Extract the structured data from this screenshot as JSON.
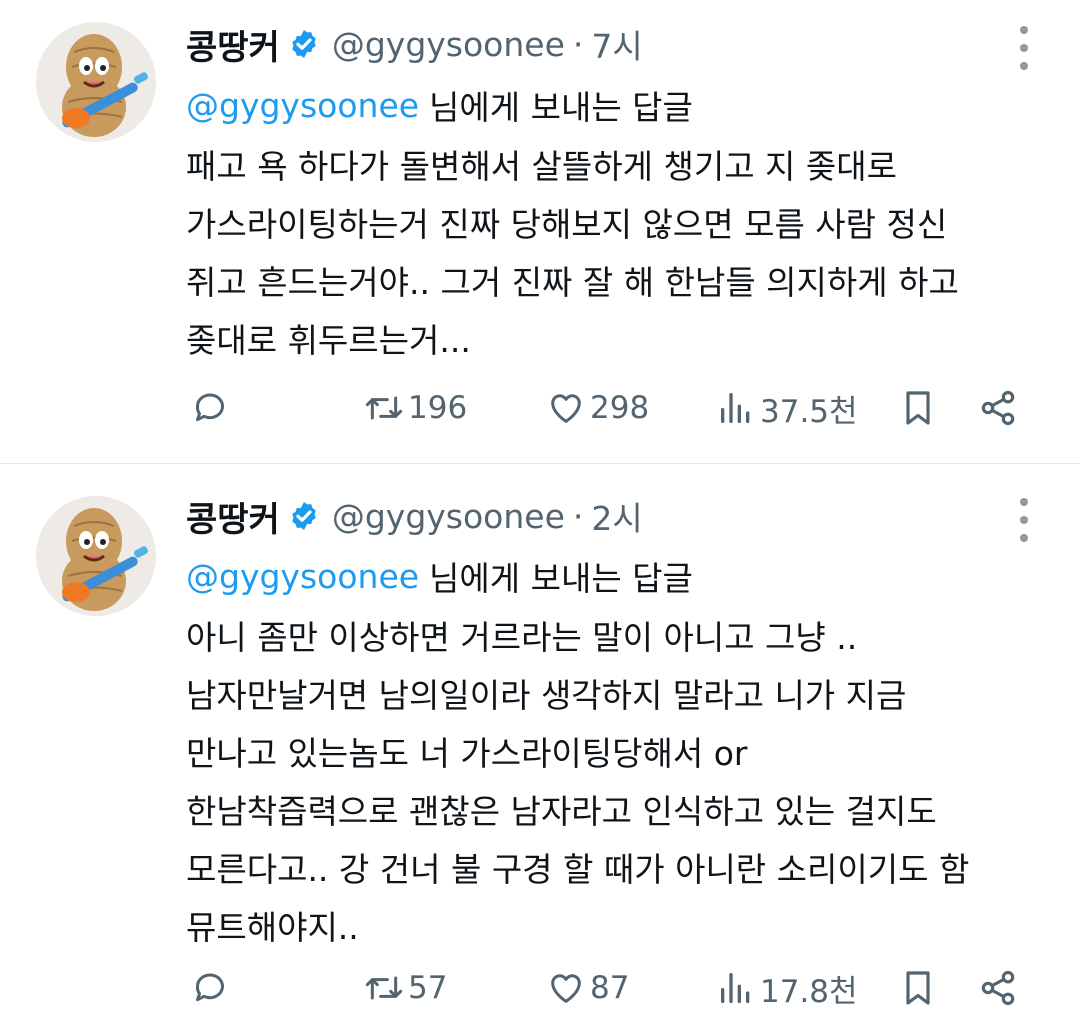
{
  "tweets": [
    {
      "author": {
        "name": "콩땅커",
        "handle": "@gygysoonee"
      },
      "time": "7시",
      "reply_to": {
        "handle": "@gygysoonee",
        "suffix": "님에게 보내는 답글"
      },
      "lines": [
        "패고 욕 하다가 돌변해서 살뜰하게 챙기고 지 좆대로",
        "가스라이팅하는거 진짜 당해보지 않으면 모름 사람 정신",
        "쥐고 흔드는거야.. 그거 진짜 잘 해 한남들 의지하게 하고",
        "좆대로 휘두르는거..."
      ],
      "stats": {
        "retweets": "196",
        "likes": "298",
        "views": "37.5천"
      }
    },
    {
      "author": {
        "name": "콩땅커",
        "handle": "@gygysoonee"
      },
      "time": "2시",
      "reply_to": {
        "handle": "@gygysoonee",
        "suffix": "님에게 보내는 답글"
      },
      "lines": [
        "아니 좀만 이상하면 거르라는 말이 아니고 그냥 ..",
        "남자만날거면 남의일이라 생각하지 말라고 니가 지금",
        "만나고 있는놈도 너 가스라이팅당해서 or",
        "한남착즙력으로 괜찮은 남자라고 인식하고 있는 걸지도",
        "모른다고.. 강 건너 불 구경 할 때가 아니란 소리이기도 함",
        "뮤트해야지.."
      ],
      "stats": {
        "retweets": "57",
        "likes": "87",
        "views": "17.8천"
      }
    }
  ],
  "icons": {
    "verified": "verified-badge-icon",
    "more": "more-vertical-icon",
    "reply": "reply-icon",
    "retweet": "retweet-icon",
    "like": "heart-icon",
    "views": "views-icon",
    "bookmark": "bookmark-icon",
    "share": "share-icon"
  },
  "colors": {
    "accent": "#1d9bf0",
    "muted": "#536471",
    "text": "#0f1419"
  }
}
